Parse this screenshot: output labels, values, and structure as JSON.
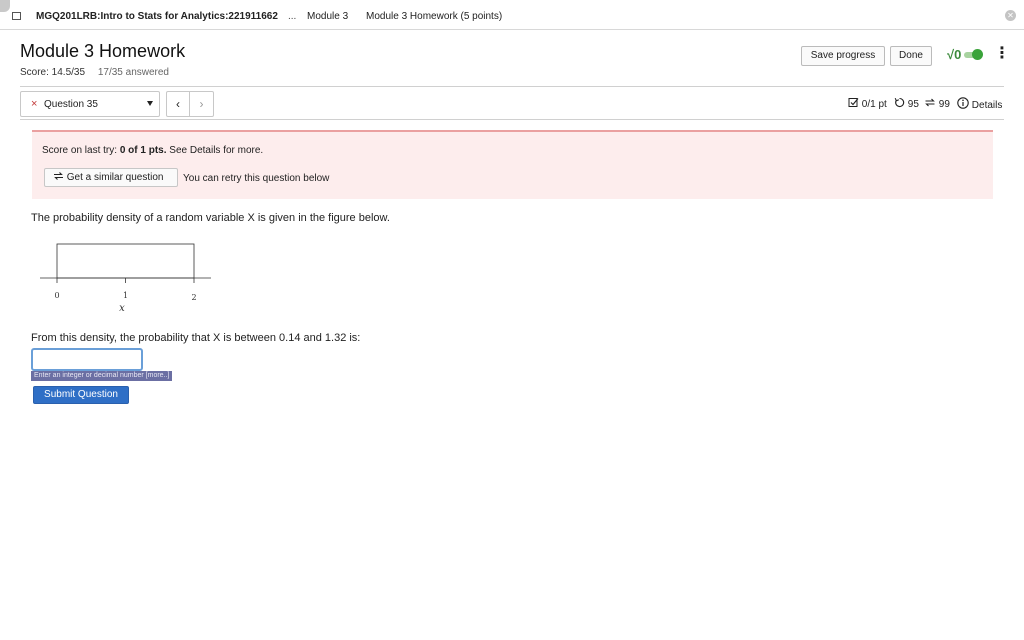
{
  "topbar": {
    "course": "MGQ201LRB:Intro to Stats for Analytics:221911662",
    "ellipsis": "...",
    "module": "Module 3",
    "assignment": "Module 3 Homework (5 points)"
  },
  "header": {
    "title": "Module 3 Homework",
    "score": "Score: 14.5/35",
    "answered": "17/35 answered",
    "save_label": "Save progress",
    "done_label": "Done",
    "math_symbol": "√0",
    "menu_icon": "⋮"
  },
  "question_nav": {
    "selected": "Question 35",
    "status_icon": "×",
    "prev": "‹",
    "next": "›",
    "points": "0/1 pt",
    "tries_left": "95",
    "versions": "99",
    "details_label": "Details"
  },
  "feedback": {
    "last_try_prefix": "Score on last try: ",
    "last_try_score": "0 of 1 pts.",
    "last_try_suffix": " See Details for more.",
    "similar_label": "Get a similar question",
    "retry_text": "You can retry this question below"
  },
  "question": {
    "intro": "The probability density of a random variable X is given in the figure below.",
    "prompt": "From this density, the probability that X is between 0.14 and 1.32 is:",
    "answer_value": "",
    "hint": "Enter an integer or decimal number [more..]",
    "submit_label": "Submit Question"
  },
  "figure": {
    "x_ticks": [
      "0",
      "1",
      "2"
    ],
    "x_label": "x"
  },
  "colors": {
    "accent": "#2f6fc6",
    "error": "#c23b3b",
    "feedback_bg": "#fdeded",
    "toggle_on": "#3aa33a"
  }
}
